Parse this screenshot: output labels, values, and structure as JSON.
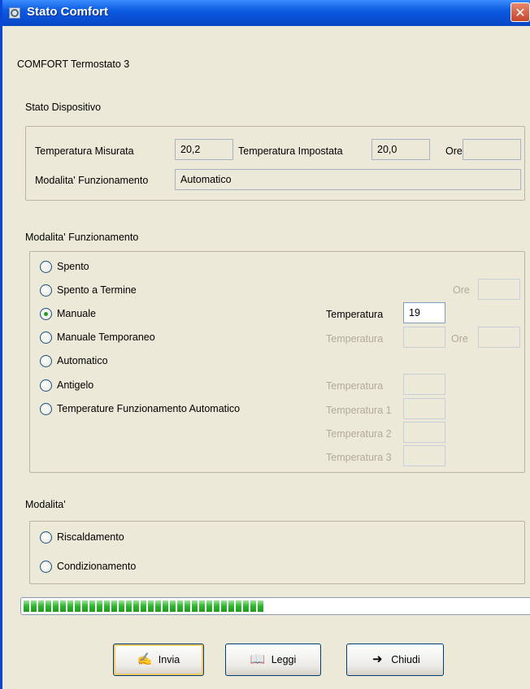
{
  "window": {
    "title": "Stato Comfort"
  },
  "header": {
    "device_title": "COMFORT  Termostato 3"
  },
  "stato": {
    "section_label": "Stato Dispositivo",
    "temp_misurata_label": "Temperatura Misurata",
    "temp_misurata_value": "20,2",
    "temp_impostata_label": "Temperatura Impostata",
    "temp_impostata_value": "20,0",
    "ore_label": "Ore",
    "ore_value": "",
    "modalita_label": "Modalita' Funzionamento",
    "modalita_value": "Automatico"
  },
  "funzionamento": {
    "section_label": "Modalita' Funzionamento",
    "options": [
      {
        "label": "Spento",
        "selected": false
      },
      {
        "label": "Spento a Termine",
        "selected": false
      },
      {
        "label": "Manuale",
        "selected": true
      },
      {
        "label": "Manuale Temporaneo",
        "selected": false
      },
      {
        "label": "Automatico",
        "selected": false
      },
      {
        "label": "Antigelo",
        "selected": false
      },
      {
        "label": "Temperature Funzionamento Automatico",
        "selected": false
      }
    ],
    "ore_label": "Ore",
    "temperatura_label": "Temperatura",
    "manuale_temperatura_value": "19",
    "temperatura_1_label": "Temperatura 1",
    "temperatura_2_label": "Temperatura 2",
    "temperatura_3_label": "Temperatura 3"
  },
  "modalita": {
    "section_label": "Modalita'",
    "options": [
      {
        "label": "Riscaldamento",
        "selected": false
      },
      {
        "label": "Condizionamento",
        "selected": false
      }
    ]
  },
  "progress": {
    "fraction": 0.48
  },
  "buttons": {
    "invia": "Invia",
    "leggi": "Leggi",
    "chiudi": "Chiudi"
  },
  "icons": {
    "invia": "sign-pen-icon",
    "leggi": "book-icon",
    "chiudi": "arrow-right-icon"
  },
  "colors": {
    "titlebar": "#0b5be0",
    "progress": "#2fb52f",
    "radio_selected": "#21a121"
  }
}
